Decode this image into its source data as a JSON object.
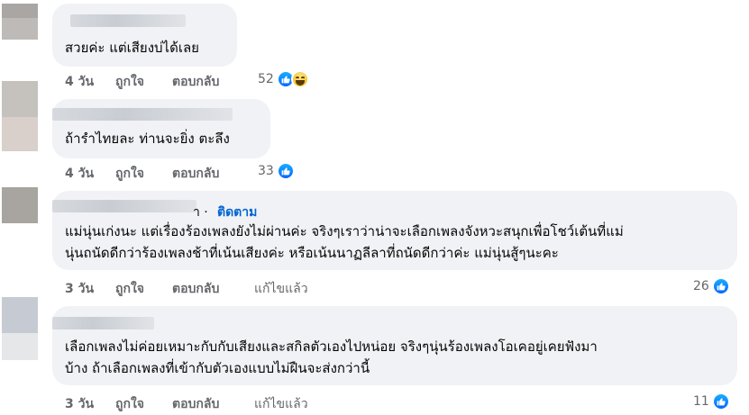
{
  "comments": [
    {
      "text_lines": [
        "สวยค่ะ แต่เสียงบ่ได้เลย"
      ],
      "time": "4 วัน",
      "like_label": "ถูกใจ",
      "reply_label": "ตอบกลับ",
      "reaction_count": "52",
      "reactions": [
        "like-icon",
        "haha-icon"
      ]
    },
    {
      "text_lines": [
        "ถ้ารำไทยละ ท่านจะยิ่ง ตะลึง"
      ],
      "time": "4 วัน",
      "like_label": "ถูกใจ",
      "reply_label": "ตอบกลับ",
      "reaction_count": "33",
      "reactions": [
        "like-icon"
      ]
    },
    {
      "name_tail": "า ·",
      "follow_label": "ติดตาม",
      "text_lines": [
        "แม่นุ่นเก่งนะ แต่เรื่องร้องเพลงยังไม่ผ่านค่ะ จริงๆเราว่าน่าจะเลือกเพลงจังหวะสนุกเพื่อโชว์เต้นที่แม่",
        "นุ่นถนัดดีกว่าร้องเพลงช้าที่เน้นเสียงค่ะ หรือเน้นนาฏลีลาที่ถนัดดีกว่าค่ะ แม่นุ่นสู้ๆนะคะ"
      ],
      "time": "3 วัน",
      "like_label": "ถูกใจ",
      "reply_label": "ตอบกลับ",
      "edited_label": "แก้ไขแล้ว",
      "reaction_count": "26",
      "reactions": [
        "like-icon"
      ]
    },
    {
      "text_lines": [
        "เลือกเพลงไม่ค่อยเหมาะกับกับเสียงและสกิลตัวเองไปหน่อย จริงๆนุ่นร้องเพลงโอเคอยู่เคยฟังมา",
        "บ้าง ถ้าเลือกเพลงที่เข้ากับตัวเองแบบไม่ฝืนจะส่งกว่านี้"
      ],
      "time": "3 วัน",
      "like_label": "ถูกใจ",
      "reply_label": "ตอบกลับ",
      "edited_label": "แก้ไขแล้ว",
      "reaction_count": "11",
      "reactions": [
        "like-icon"
      ]
    }
  ],
  "colors": {
    "bubble": "#f0f2f5",
    "action_text": "#65676b",
    "follow_link": "#0064d1",
    "like_blue": "#0866ff"
  }
}
